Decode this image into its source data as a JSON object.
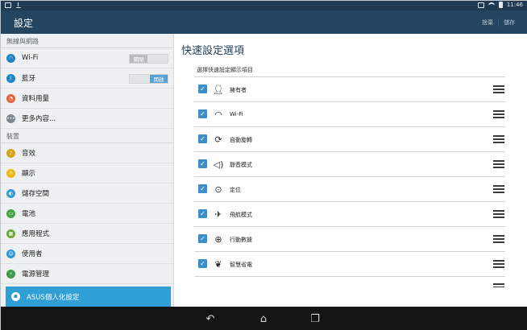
{
  "status_bar": {
    "time": "11:46"
  },
  "app_bar": {
    "title": "設定",
    "actions": [
      "捨棄",
      "儲存"
    ]
  },
  "left_panel": {
    "section_network": "無線與網路",
    "network_items": [
      {
        "label": "Wi-Fi",
        "icon": "wifi-icon",
        "color": "#1f84c6",
        "toggle": "關閉",
        "toggle_state": "off"
      },
      {
        "label": "藍牙",
        "icon": "bluetooth-icon",
        "color": "#1f84c6",
        "toggle": "開啟",
        "toggle_state": "on"
      },
      {
        "label": "資料用量",
        "icon": "data-usage-icon",
        "color": "#e2643a"
      },
      {
        "label": "更多內容...",
        "icon": "more-icon",
        "color": "#7d8790"
      }
    ],
    "section_device": "裝置",
    "device_items": [
      {
        "label": "音效",
        "icon": "sound-icon",
        "color": "#d9a21b"
      },
      {
        "label": "顯示",
        "icon": "display-icon",
        "color": "#e9b913"
      },
      {
        "label": "儲存空間",
        "icon": "storage-icon",
        "color": "#2f9ad6"
      },
      {
        "label": "電池",
        "icon": "battery-icon",
        "color": "#48a546"
      },
      {
        "label": "應用程式",
        "icon": "apps-icon",
        "color": "#6aa83a"
      },
      {
        "label": "使用者",
        "icon": "user-icon",
        "color": "#2f9ad6"
      },
      {
        "label": "電源管理",
        "icon": "power-management-icon",
        "color": "#3f9b4a"
      }
    ],
    "selected_item": {
      "label": "ASUS個人化設定",
      "icon": "asus-customized-icon"
    }
  },
  "right_panel": {
    "title": "快速設定選項",
    "subtitle": "選擇快速設定顯示項目",
    "items": [
      {
        "label": "擁有者",
        "icon": "person-icon"
      },
      {
        "label": "Wi-Fi",
        "icon": "wifi-icon"
      },
      {
        "label": "自動旋轉",
        "icon": "auto-rotate-icon"
      },
      {
        "label": "靜音模式",
        "icon": "silent-mode-icon"
      },
      {
        "label": "定位",
        "icon": "location-icon"
      },
      {
        "label": "飛航模式",
        "icon": "airplane-icon"
      },
      {
        "label": "行動數據",
        "icon": "mobile-data-icon"
      },
      {
        "label": "智慧省電",
        "icon": "smart-power-saving-icon"
      }
    ]
  },
  "colors": {
    "appbar": "#24455f",
    "accent": "#2f9fd5",
    "checkbox": "#3a8fca"
  }
}
